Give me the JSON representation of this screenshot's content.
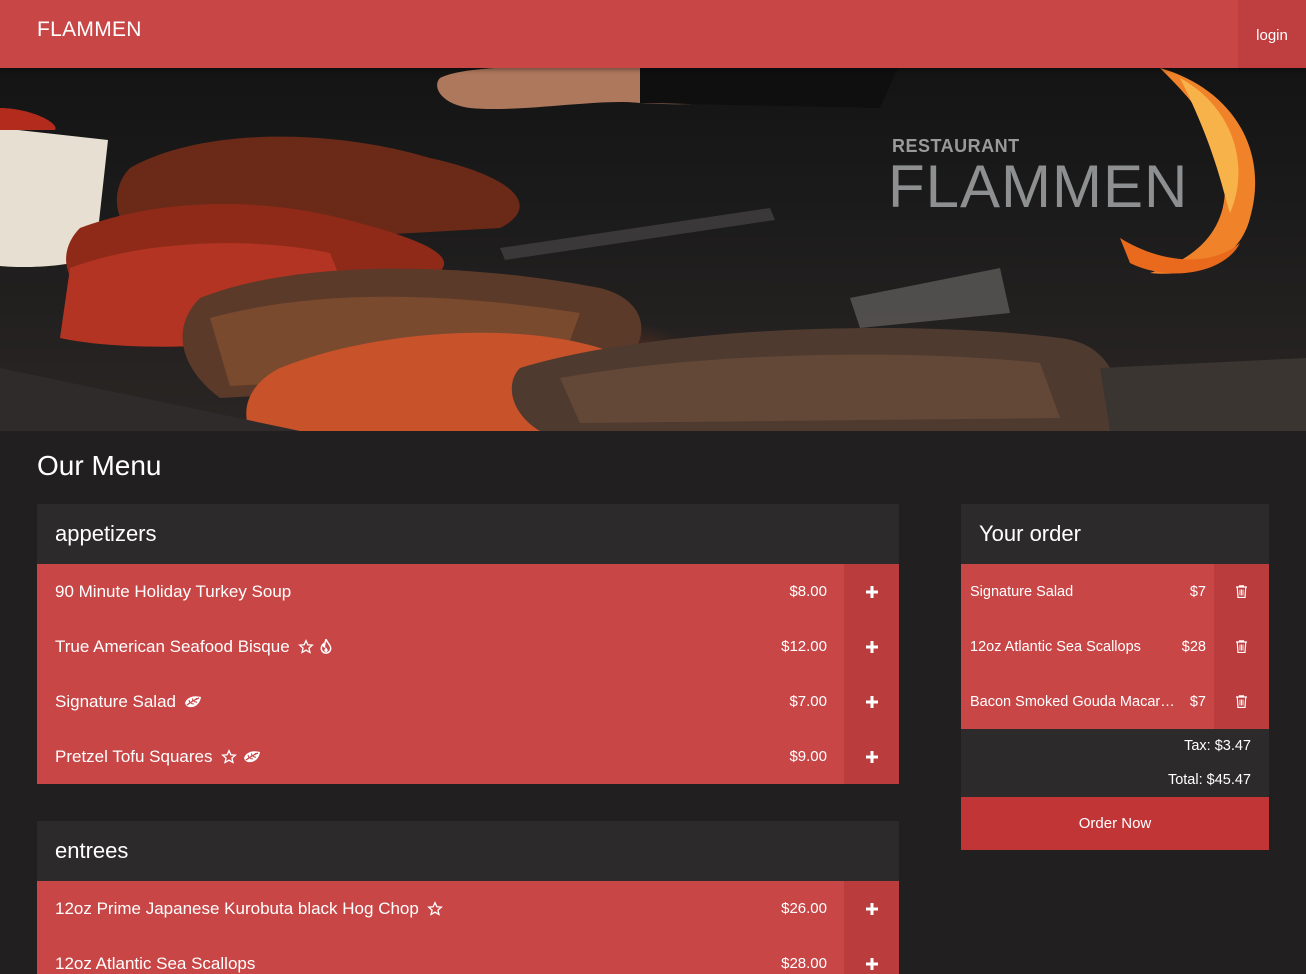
{
  "header": {
    "brand": "FLAMMEN",
    "login_label": "login"
  },
  "hero": {
    "logo_small": "RESTAURANT",
    "logo_large": "FLAMMEN"
  },
  "menu": {
    "title": "Our Menu",
    "categories": [
      {
        "name": "appetizers",
        "items": [
          {
            "name": "90 Minute Holiday Turkey Soup",
            "price": "$8.00",
            "icons": []
          },
          {
            "name": "True American Seafood Bisque",
            "price": "$12.00",
            "icons": [
              "star-icon",
              "flame-icon"
            ]
          },
          {
            "name": "Signature Salad",
            "price": "$7.00",
            "icons": [
              "leaf-icon"
            ]
          },
          {
            "name": "Pretzel Tofu Squares",
            "price": "$9.00",
            "icons": [
              "star-icon",
              "leaf-icon"
            ]
          }
        ]
      },
      {
        "name": "entrees",
        "items": [
          {
            "name": "12oz Prime Japanese Kurobuta black Hog Chop",
            "price": "$26.00",
            "icons": [
              "star-icon"
            ]
          },
          {
            "name": "12oz Atlantic Sea Scallops",
            "price": "$28.00",
            "icons": []
          }
        ]
      }
    ]
  },
  "order": {
    "title": "Your order",
    "items": [
      {
        "name": "Signature Salad",
        "price": "$7"
      },
      {
        "name": "12oz Atlantic Sea Scallops",
        "price": "$28"
      },
      {
        "name": "Bacon Smoked Gouda Macaroni",
        "price": "$7"
      }
    ],
    "tax": "Tax: $3.47",
    "total": "Total: $45.47",
    "order_button": "Order Now"
  },
  "colors": {
    "primary_red": "#c94647",
    "dark_red": "#bb3c3d",
    "button_red": "#c23537",
    "background": "#221f21",
    "panel_header": "#2d2a2b"
  }
}
